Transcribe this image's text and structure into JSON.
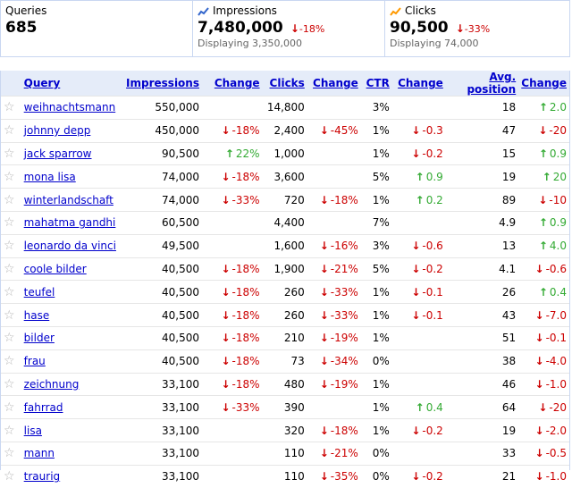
{
  "summary": {
    "queries": {
      "label": "Queries",
      "value": "685"
    },
    "impressions": {
      "label": "Impressions",
      "value": "7,480,000",
      "change": "-18%",
      "displaying": "Displaying 3,350,000"
    },
    "clicks": {
      "label": "Clicks",
      "value": "90,500",
      "change": "-33%",
      "displaying": "Displaying 74,000"
    }
  },
  "columns": {
    "query": "Query",
    "impressions": "Impressions",
    "change": "Change",
    "clicks": "Clicks",
    "ctr": "CTR",
    "avg_position": "Avg. position"
  },
  "icons": {
    "star": "star-icon",
    "up_arrow": "up-arrow-icon",
    "down_arrow": "down-arrow-icon"
  },
  "colors": {
    "green": "#33aa33",
    "red": "#cc0000",
    "link": "#0000cc",
    "header_bg": "#e5ecf9"
  },
  "rows": [
    {
      "query": "weihnachtsmann",
      "impressions": "550,000",
      "imp_change": "",
      "imp_dir": "",
      "clicks": "14,800",
      "clk_change": "",
      "clk_dir": "",
      "ctr": "3%",
      "ctr_change": "",
      "ctr_dir": "",
      "pos": "18",
      "pos_change": "2.0",
      "pos_dir": "up"
    },
    {
      "query": "johnny depp",
      "impressions": "450,000",
      "imp_change": "-18%",
      "imp_dir": "down",
      "clicks": "2,400",
      "clk_change": "-45%",
      "clk_dir": "down",
      "ctr": "1%",
      "ctr_change": "-0.3",
      "ctr_dir": "down",
      "pos": "47",
      "pos_change": "-20",
      "pos_dir": "down"
    },
    {
      "query": "jack sparrow",
      "impressions": "90,500",
      "imp_change": "22%",
      "imp_dir": "up",
      "clicks": "1,000",
      "clk_change": "",
      "clk_dir": "",
      "ctr": "1%",
      "ctr_change": "-0.2",
      "ctr_dir": "down",
      "pos": "15",
      "pos_change": "0.9",
      "pos_dir": "up"
    },
    {
      "query": "mona lisa",
      "impressions": "74,000",
      "imp_change": "-18%",
      "imp_dir": "down",
      "clicks": "3,600",
      "clk_change": "",
      "clk_dir": "",
      "ctr": "5%",
      "ctr_change": "0.9",
      "ctr_dir": "up",
      "pos": "19",
      "pos_change": "20",
      "pos_dir": "up"
    },
    {
      "query": "winterlandschaft",
      "impressions": "74,000",
      "imp_change": "-33%",
      "imp_dir": "down",
      "clicks": "720",
      "clk_change": "-18%",
      "clk_dir": "down",
      "ctr": "1%",
      "ctr_change": "0.2",
      "ctr_dir": "up",
      "pos": "89",
      "pos_change": "-10",
      "pos_dir": "down"
    },
    {
      "query": "mahatma gandhi",
      "impressions": "60,500",
      "imp_change": "",
      "imp_dir": "",
      "clicks": "4,400",
      "clk_change": "",
      "clk_dir": "",
      "ctr": "7%",
      "ctr_change": "",
      "ctr_dir": "",
      "pos": "4.9",
      "pos_change": "0.9",
      "pos_dir": "up"
    },
    {
      "query": "leonardo da vinci",
      "impressions": "49,500",
      "imp_change": "",
      "imp_dir": "",
      "clicks": "1,600",
      "clk_change": "-16%",
      "clk_dir": "down",
      "ctr": "3%",
      "ctr_change": "-0.6",
      "ctr_dir": "down",
      "pos": "13",
      "pos_change": "4.0",
      "pos_dir": "up"
    },
    {
      "query": "coole bilder",
      "impressions": "40,500",
      "imp_change": "-18%",
      "imp_dir": "down",
      "clicks": "1,900",
      "clk_change": "-21%",
      "clk_dir": "down",
      "ctr": "5%",
      "ctr_change": "-0.2",
      "ctr_dir": "down",
      "pos": "4.1",
      "pos_change": "-0.6",
      "pos_dir": "down"
    },
    {
      "query": "teufel",
      "impressions": "40,500",
      "imp_change": "-18%",
      "imp_dir": "down",
      "clicks": "260",
      "clk_change": "-33%",
      "clk_dir": "down",
      "ctr": "1%",
      "ctr_change": "-0.1",
      "ctr_dir": "down",
      "pos": "26",
      "pos_change": "0.4",
      "pos_dir": "up"
    },
    {
      "query": "hase",
      "impressions": "40,500",
      "imp_change": "-18%",
      "imp_dir": "down",
      "clicks": "260",
      "clk_change": "-33%",
      "clk_dir": "down",
      "ctr": "1%",
      "ctr_change": "-0.1",
      "ctr_dir": "down",
      "pos": "43",
      "pos_change": "-7.0",
      "pos_dir": "down"
    },
    {
      "query": "bilder",
      "impressions": "40,500",
      "imp_change": "-18%",
      "imp_dir": "down",
      "clicks": "210",
      "clk_change": "-19%",
      "clk_dir": "down",
      "ctr": "1%",
      "ctr_change": "",
      "ctr_dir": "",
      "pos": "51",
      "pos_change": "-0.1",
      "pos_dir": "down"
    },
    {
      "query": "frau",
      "impressions": "40,500",
      "imp_change": "-18%",
      "imp_dir": "down",
      "clicks": "73",
      "clk_change": "-34%",
      "clk_dir": "down",
      "ctr": "0%",
      "ctr_change": "",
      "ctr_dir": "",
      "pos": "38",
      "pos_change": "-4.0",
      "pos_dir": "down"
    },
    {
      "query": "zeichnung",
      "impressions": "33,100",
      "imp_change": "-18%",
      "imp_dir": "down",
      "clicks": "480",
      "clk_change": "-19%",
      "clk_dir": "down",
      "ctr": "1%",
      "ctr_change": "",
      "ctr_dir": "",
      "pos": "46",
      "pos_change": "-1.0",
      "pos_dir": "down"
    },
    {
      "query": "fahrrad",
      "impressions": "33,100",
      "imp_change": "-33%",
      "imp_dir": "down",
      "clicks": "390",
      "clk_change": "",
      "clk_dir": "",
      "ctr": "1%",
      "ctr_change": "0.4",
      "ctr_dir": "up",
      "pos": "64",
      "pos_change": "-20",
      "pos_dir": "down"
    },
    {
      "query": "lisa",
      "impressions": "33,100",
      "imp_change": "",
      "imp_dir": "",
      "clicks": "320",
      "clk_change": "-18%",
      "clk_dir": "down",
      "ctr": "1%",
      "ctr_change": "-0.2",
      "ctr_dir": "down",
      "pos": "19",
      "pos_change": "-2.0",
      "pos_dir": "down"
    },
    {
      "query": "mann",
      "impressions": "33,100",
      "imp_change": "",
      "imp_dir": "",
      "clicks": "110",
      "clk_change": "-21%",
      "clk_dir": "down",
      "ctr": "0%",
      "ctr_change": "",
      "ctr_dir": "",
      "pos": "33",
      "pos_change": "-0.5",
      "pos_dir": "down"
    },
    {
      "query": "traurig",
      "impressions": "33,100",
      "imp_change": "",
      "imp_dir": "",
      "clicks": "110",
      "clk_change": "-35%",
      "clk_dir": "down",
      "ctr": "0%",
      "ctr_change": "-0.2",
      "ctr_dir": "down",
      "pos": "21",
      "pos_change": "-1.0",
      "pos_dir": "down"
    }
  ]
}
